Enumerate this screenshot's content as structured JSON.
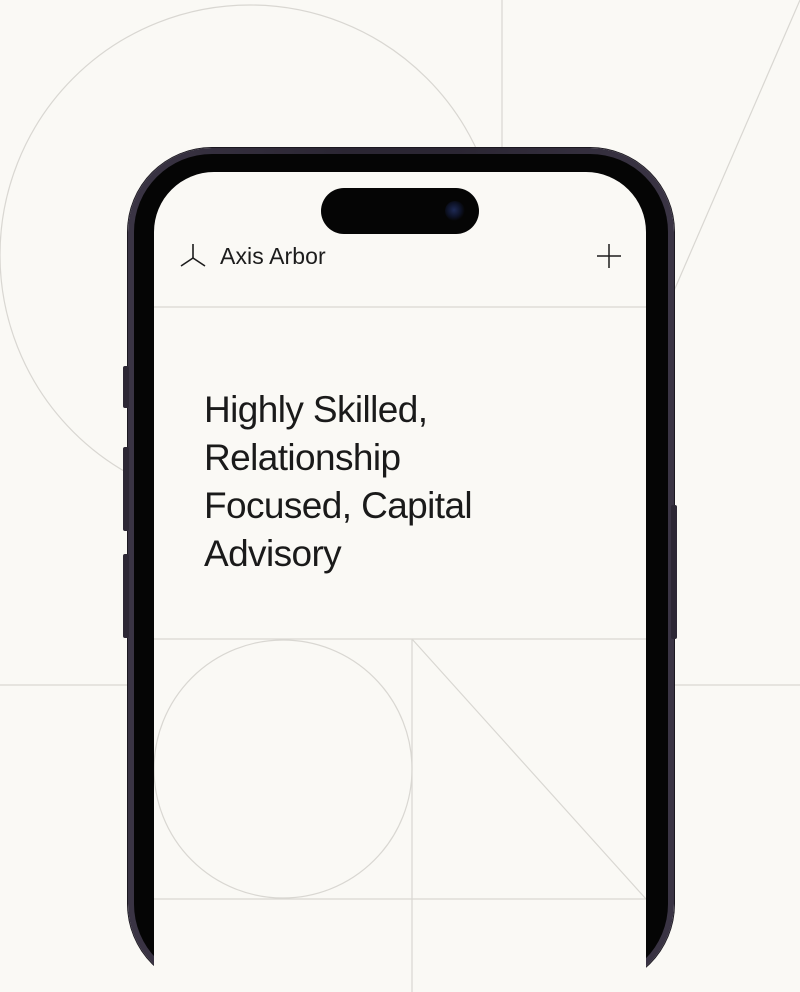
{
  "header": {
    "brand_name": "Axis Arbor",
    "logo_icon": "tripod-icon",
    "menu_icon": "plus-icon"
  },
  "hero": {
    "headline_lines": [
      "Highly Skilled,",
      "Relationship",
      "Focused, Capital",
      "Advisory"
    ]
  },
  "colors": {
    "background": "#faf9f5",
    "line": "#d9d7d2",
    "text": "#1a1a1a",
    "phone_frame": "#2b2633"
  }
}
